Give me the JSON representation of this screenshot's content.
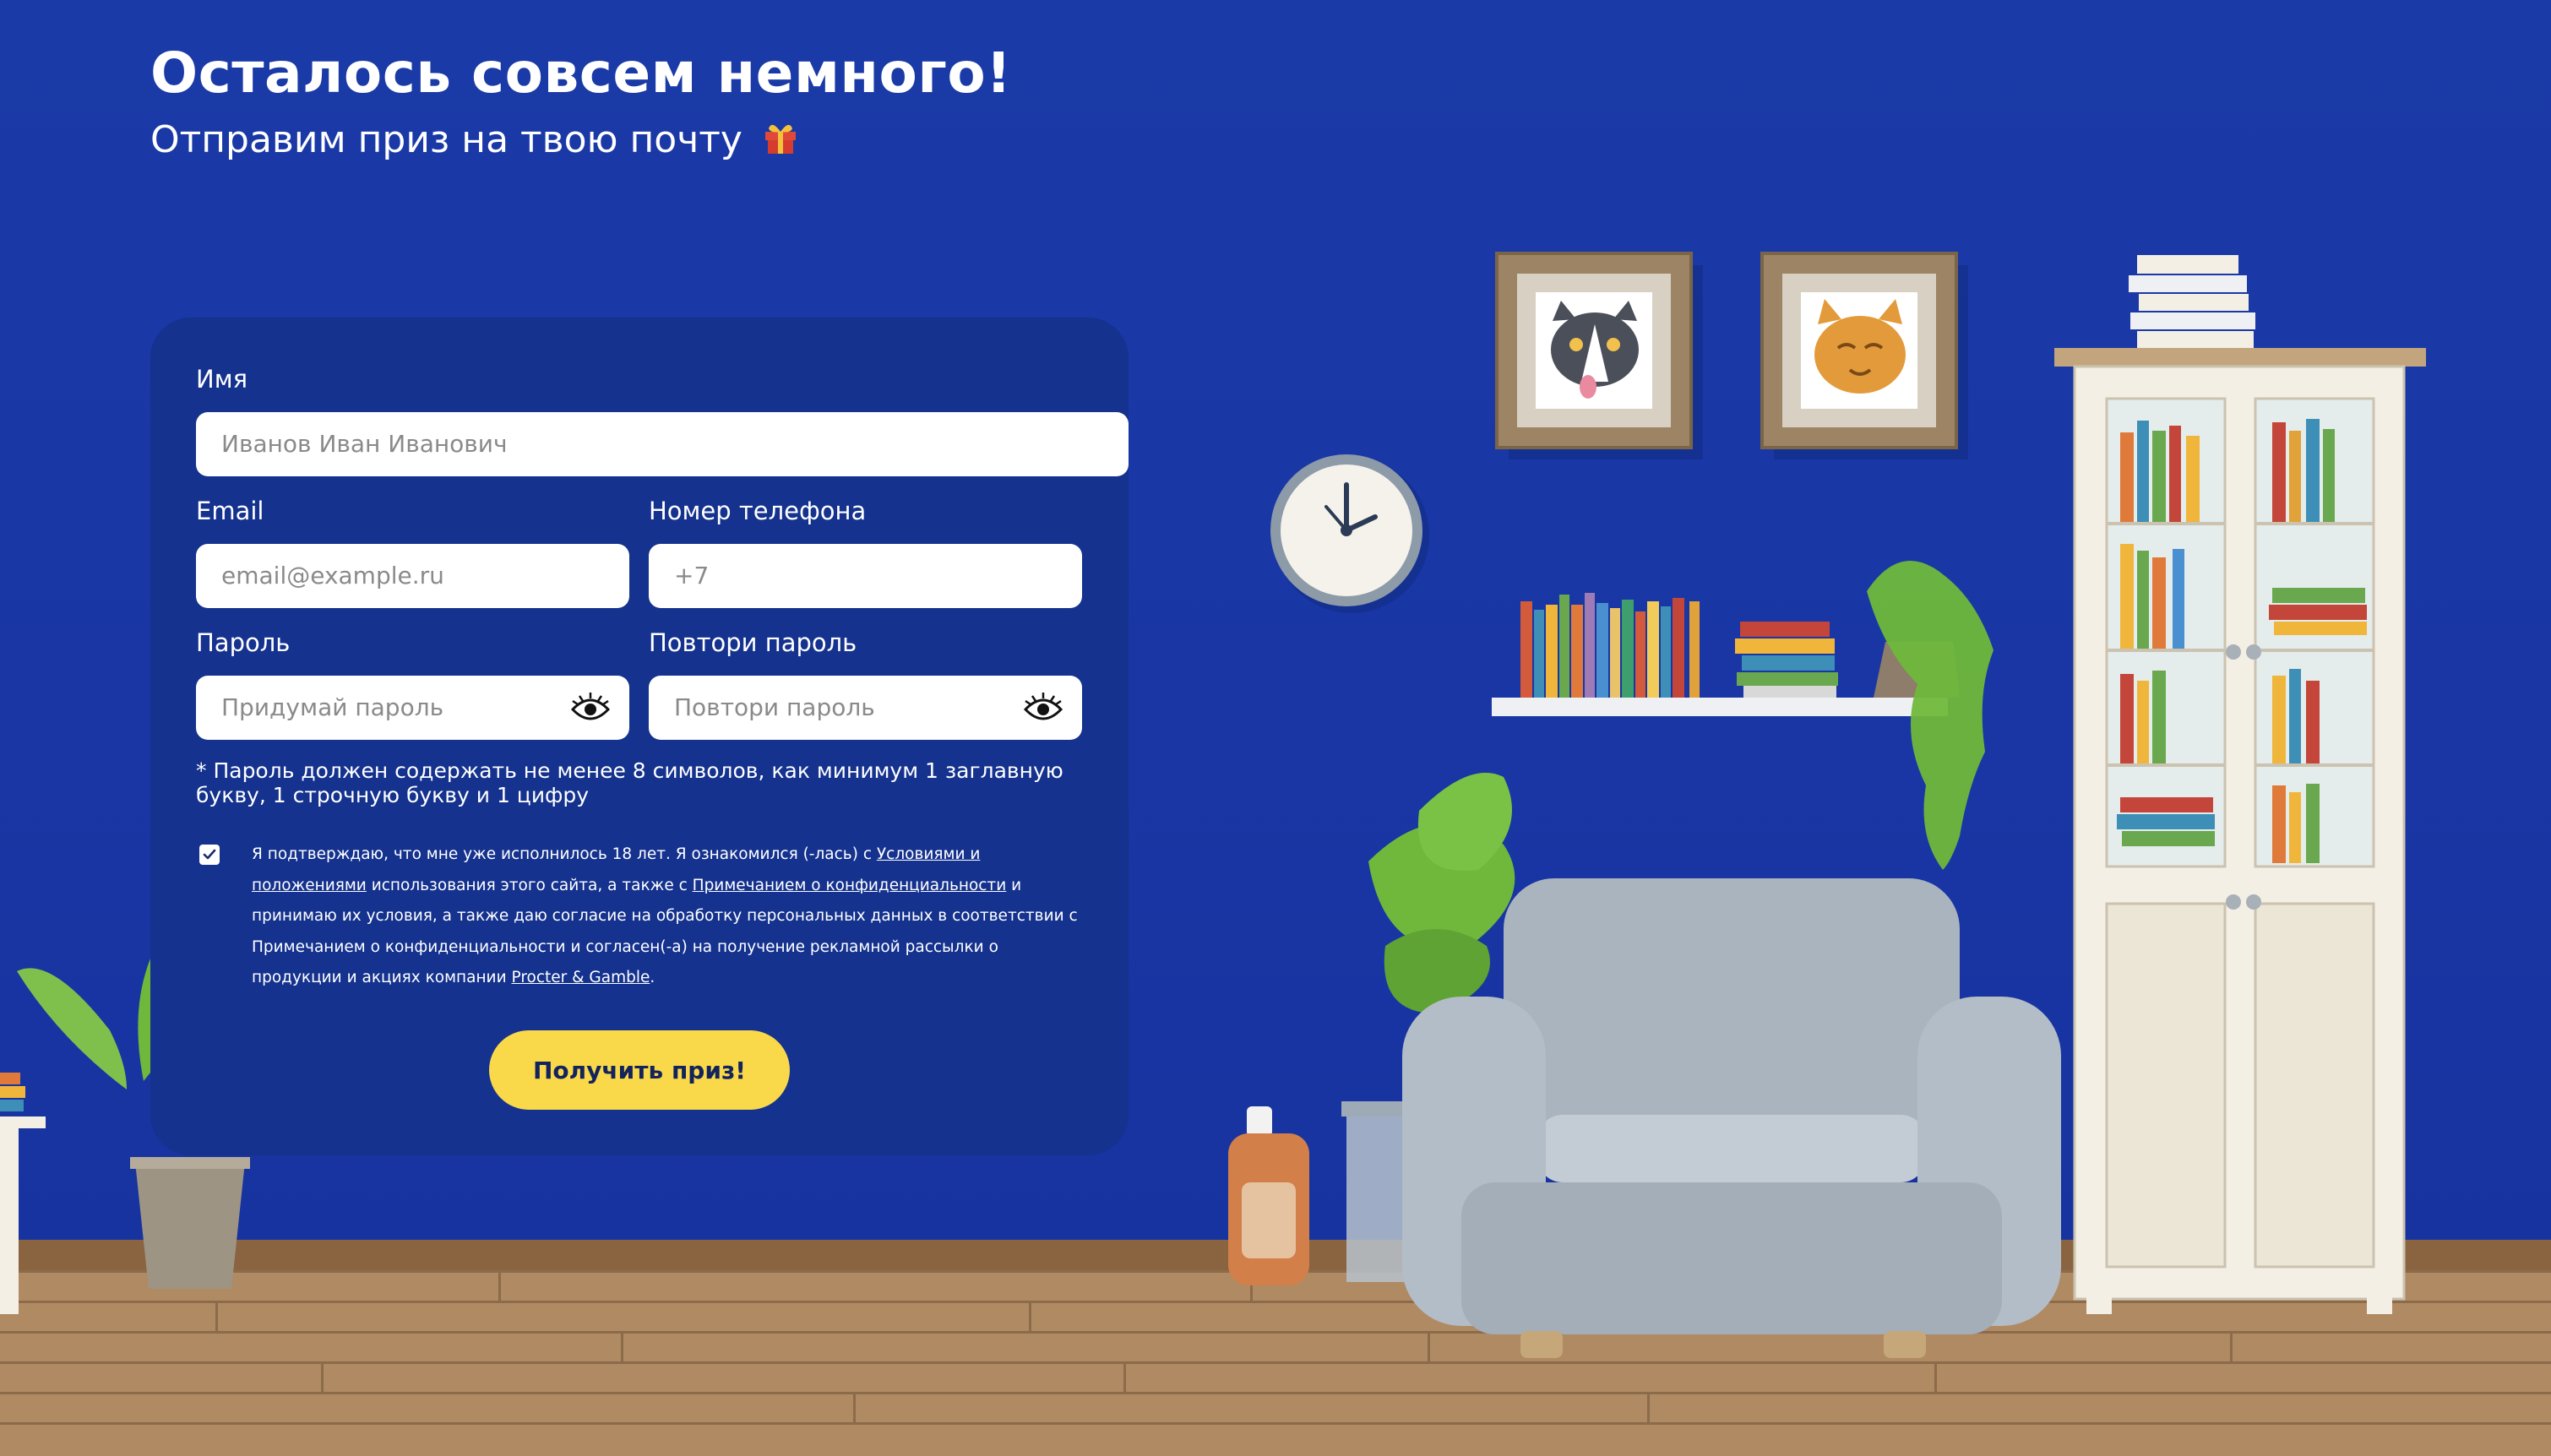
{
  "header": {
    "title": "Осталось совсем немного!",
    "subtitle": "Отправим приз на твою почту"
  },
  "form": {
    "name": {
      "label": "Имя",
      "placeholder": "Иванов Иван Иванович"
    },
    "email": {
      "label": "Email",
      "placeholder": "email@example.ru"
    },
    "phone": {
      "label": "Номер телефона",
      "placeholder": "+7"
    },
    "password": {
      "label": "Пароль",
      "placeholder": "Придумай пароль"
    },
    "password_repeat": {
      "label": "Повтори пароль",
      "placeholder": "Повтори пароль"
    },
    "password_hint": "* Пароль должен содержать не менее 8 символов, как минимум 1 заглавную букву, 1 строчную букву и 1 цифру",
    "consent": {
      "checked": true,
      "text_1": "Я подтверждаю, что мне уже исполнилось 18 лет. Я ознакомился (-лась) с ",
      "link_terms": "Условиями и положениями",
      "text_2": " использования этого сайта, а также с ",
      "link_privacy": "Примечанием о конфиденциальности",
      "text_3": " и принимаю их условия, а также даю согласие на обработку персональных данных в соответствии с Примечанием о конфиденциальности и согласен(-а) на получение рекламной рассылки о продукции и акциях компании ",
      "link_company": "Procter & Gamble",
      "text_4": "."
    },
    "submit_label": "Получить приз!"
  },
  "scene": {
    "wall_color": "#1a3aa6",
    "card_color": "#14328e",
    "button_color": "#f9d84a",
    "icons": [
      "gift-icon",
      "eye-icon",
      "checkbox-check-icon"
    ]
  }
}
